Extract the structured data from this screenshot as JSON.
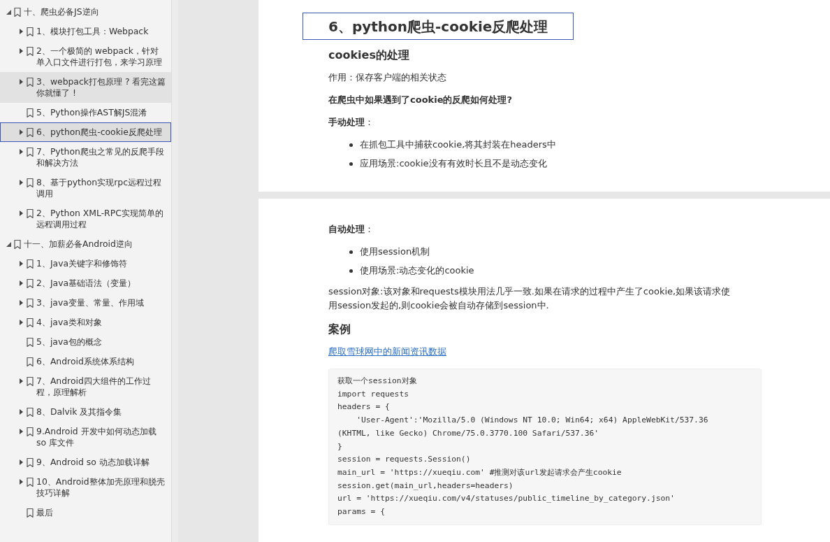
{
  "outline": [
    {
      "label": "十、爬虫必备JS逆向",
      "expanded": true,
      "children": [
        {
          "label": "1、模块打包工具：Webpack",
          "expandable": true,
          "selected": false,
          "highlighted": false
        },
        {
          "label": "2、一个极简的 webpack，针对单入口文件进行打包，来学习原理",
          "expandable": true,
          "selected": false,
          "highlighted": false
        },
        {
          "label": "3、webpack打包原理 ? 看完这篇你就懂了 !",
          "expandable": true,
          "selected": false,
          "highlighted": true
        },
        {
          "label": "5、Python操作AST解JS混淆",
          "expandable": false,
          "selected": false,
          "highlighted": false
        },
        {
          "label": "6、python爬虫-cookie反爬处理",
          "expandable": true,
          "selected": true,
          "highlighted": false
        },
        {
          "label": "7、Python爬虫之常见的反爬手段和解决方法",
          "expandable": true,
          "selected": false,
          "highlighted": false
        },
        {
          "label": "8、基于python实现rpc远程过程调用",
          "expandable": true,
          "selected": false,
          "highlighted": false
        },
        {
          "label": "2、Python XML-RPC实现简单的远程调用过程",
          "expandable": true,
          "selected": false,
          "highlighted": false
        }
      ]
    },
    {
      "label": "十一、加薪必备Android逆向",
      "expanded": true,
      "children": [
        {
          "label": "1、Java关键字和修饰符",
          "expandable": true,
          "selected": false,
          "highlighted": false
        },
        {
          "label": "2、Java基础语法（变量）",
          "expandable": true,
          "selected": false,
          "highlighted": false
        },
        {
          "label": "3、java变量、常量、作用域",
          "expandable": true,
          "selected": false,
          "highlighted": false
        },
        {
          "label": "4、java类和对象",
          "expandable": true,
          "selected": false,
          "highlighted": false
        },
        {
          "label": "5、java包的概念",
          "expandable": false,
          "selected": false,
          "highlighted": false
        },
        {
          "label": "6、Android系统体系结构",
          "expandable": false,
          "selected": false,
          "highlighted": false
        },
        {
          "label": "7、Android四大组件的工作过程，原理解析",
          "expandable": true,
          "selected": false,
          "highlighted": false
        },
        {
          "label": "8、Dalvik 及其指令集",
          "expandable": true,
          "selected": false,
          "highlighted": false
        },
        {
          "label": "9.Android 开发中如何动态加载 so 库文件",
          "expandable": true,
          "selected": false,
          "highlighted": false
        },
        {
          "label": "9、Android so 动态加载详解",
          "expandable": true,
          "selected": false,
          "highlighted": false
        },
        {
          "label": "10、Android整体加壳原理和脱壳技巧详解",
          "expandable": true,
          "selected": false,
          "highlighted": false
        },
        {
          "label": "最后",
          "expandable": false,
          "selected": false,
          "highlighted": false
        }
      ]
    }
  ],
  "pages": [
    {
      "blocks": [
        {
          "kind": "title",
          "text": "6、python爬虫-cookie反爬处理",
          "selected": true
        },
        {
          "kind": "heading",
          "text": "cookies的处理"
        },
        {
          "kind": "para",
          "text": "作用：保存客户端的相关状态"
        },
        {
          "kind": "para",
          "text": "**在爬虫中如果遇到了cookie的反爬如何处理?**"
        },
        {
          "kind": "para",
          "text": "**手动处理**："
        },
        {
          "kind": "bullets",
          "items": [
            "在抓包工具中捕获cookie,将其封装在headers中",
            "应用场景:cookie没有有效时长且不是动态变化"
          ]
        }
      ]
    },
    {
      "blocks": [
        {
          "kind": "para",
          "text": "**自动处理**："
        },
        {
          "kind": "bullets",
          "items": [
            "使用session机制",
            "使用场景:动态变化的cookie"
          ]
        },
        {
          "kind": "para",
          "text": "session对象:该对象和requests模块用法几乎一致.如果在请求的过程中产生了cookie,如果该请求使用session发起的,则cookie会被自动存储到session中."
        },
        {
          "kind": "heading",
          "text": "案例"
        },
        {
          "kind": "link",
          "text": "爬取雪球网中的新闻资讯数据"
        },
        {
          "kind": "code",
          "lines": [
            "获取一个session对象",
            "import requests",
            "headers = {",
            "    'User-Agent':'Mozilla/5.0 (Windows NT 10.0; Win64; x64) AppleWebKit/537.36",
            "(KHTML, like Gecko) Chrome/75.0.3770.100 Safari/537.36'",
            "}",
            "session = requests.Session()",
            "main_url = 'https://xueqiu.com' #推测对该url发起请求会产生cookie",
            "session.get(main_url,headers=headers)",
            "url = 'https://xueqiu.com/v4/statuses/public_timeline_by_category.json'",
            "params = {"
          ]
        }
      ]
    }
  ]
}
